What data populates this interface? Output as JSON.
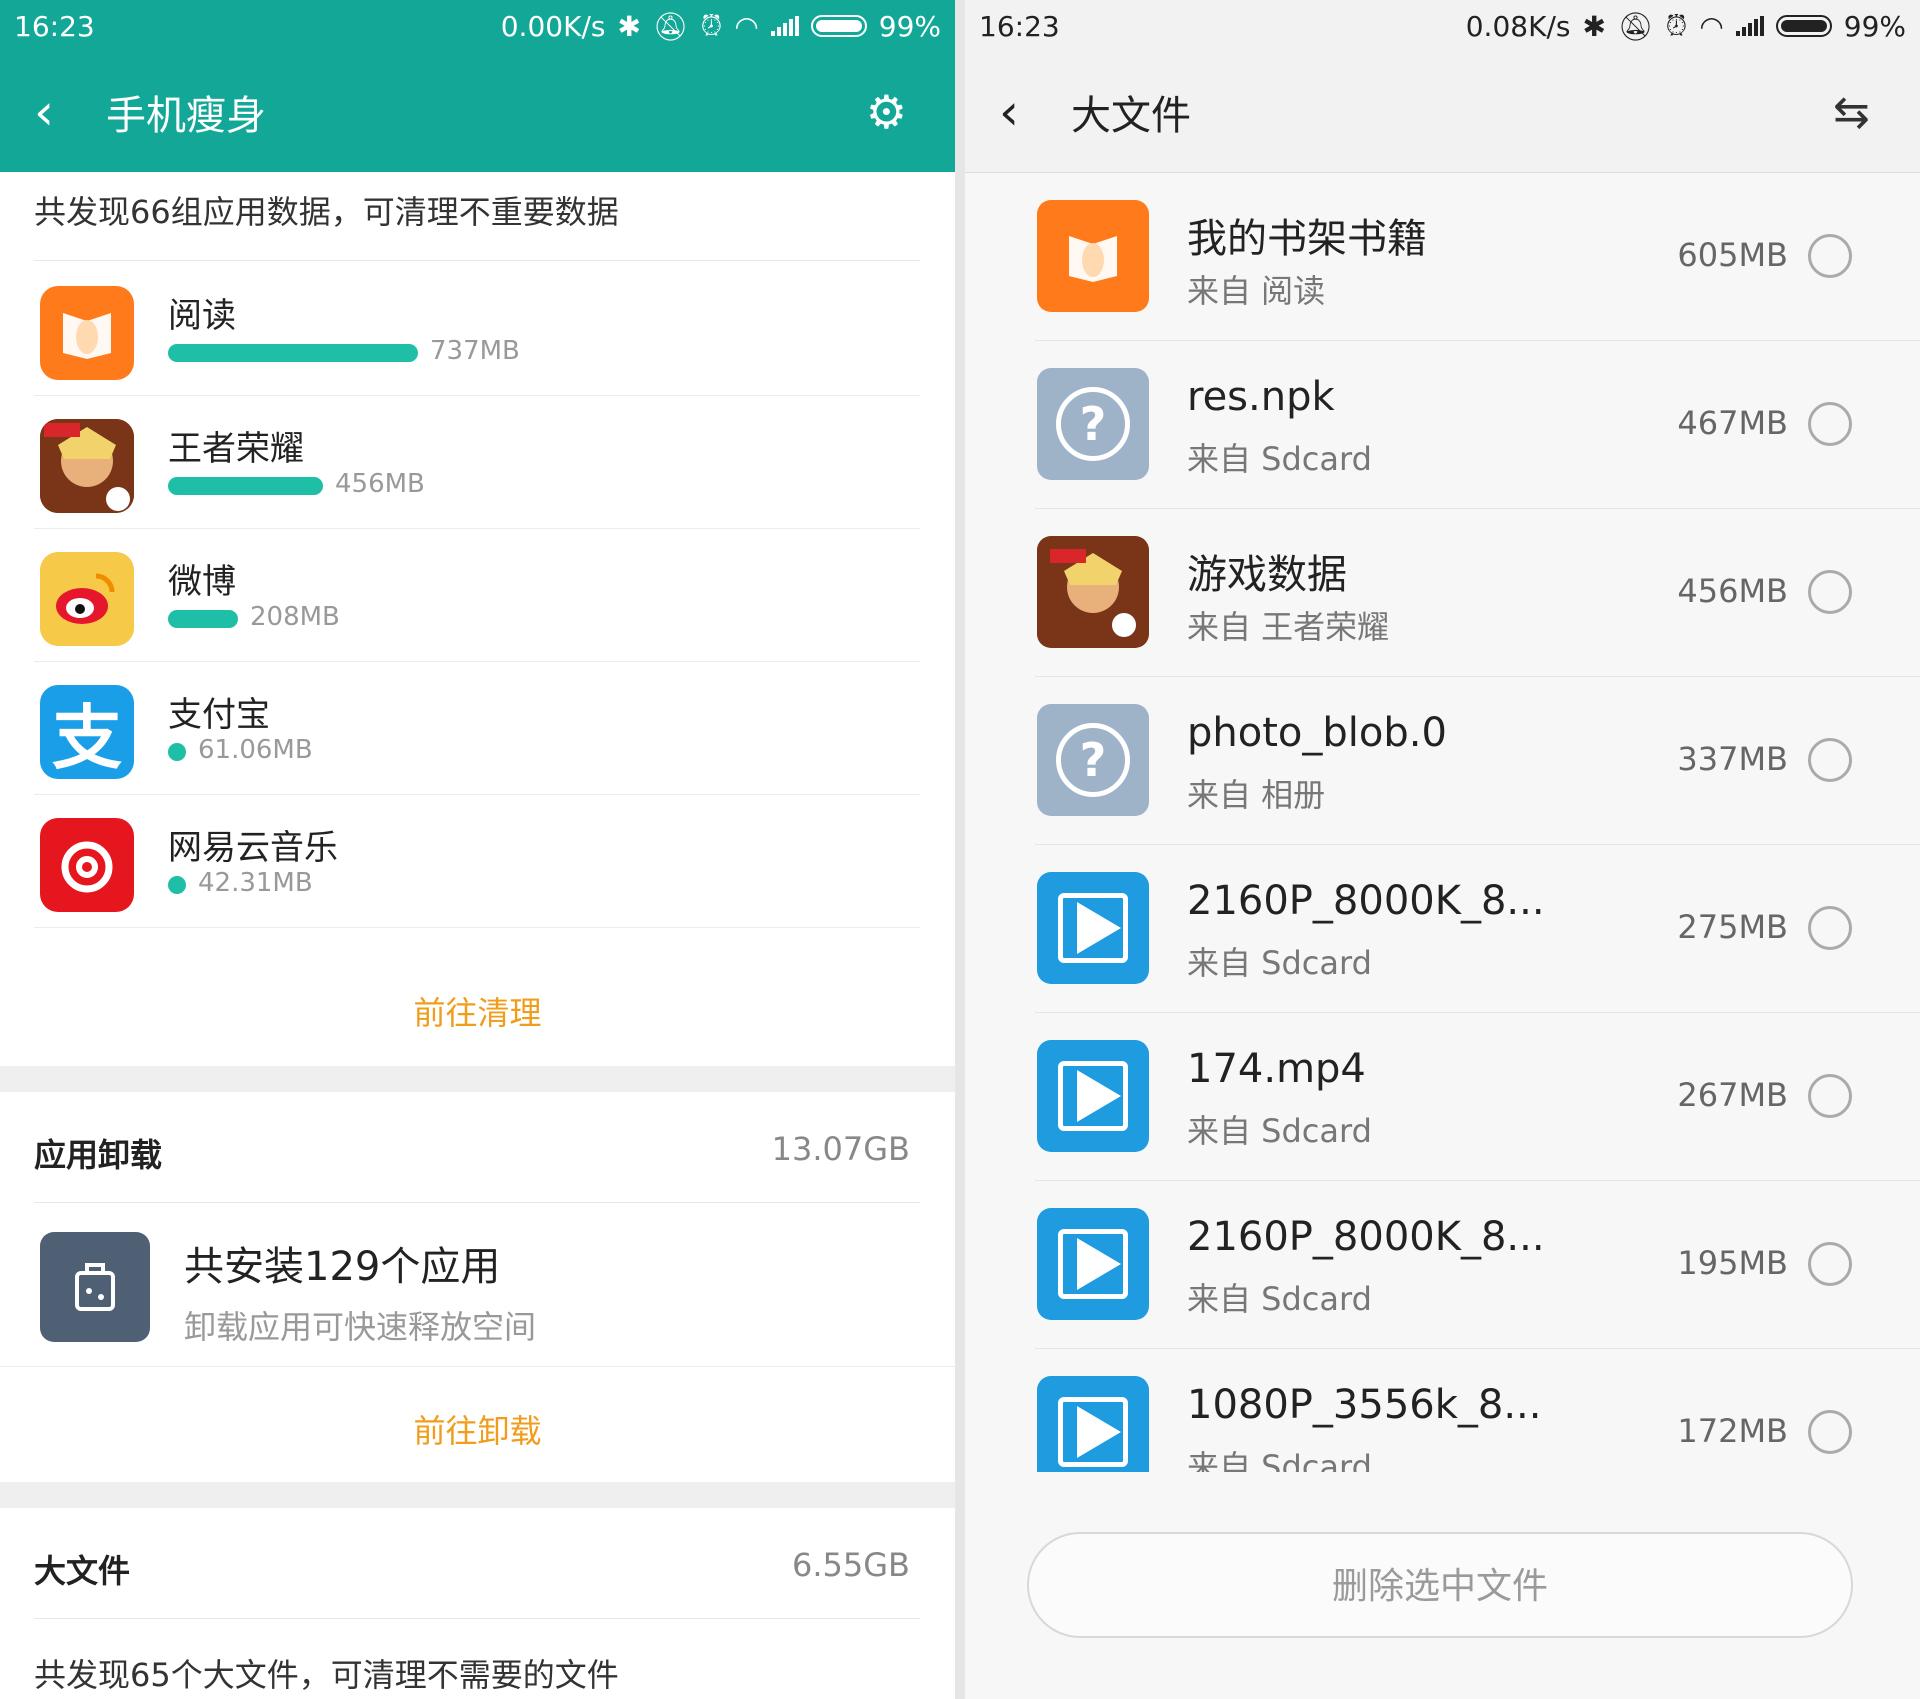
{
  "left": {
    "status": {
      "time": "16:23",
      "speed": "0.00K/s",
      "battery": "99%"
    },
    "title": "手机瘦身",
    "summary": "共发现66组应用数据，可清理不重要数据",
    "apps": [
      {
        "name": "阅读",
        "size": "737MB",
        "fraction": 1.0,
        "icon": "book-icon",
        "color": "#ff7a1a"
      },
      {
        "name": "王者荣耀",
        "size": "456MB",
        "fraction": 0.62,
        "icon": "game-hero-icon",
        "color": "#8a3a1e"
      },
      {
        "name": "微博",
        "size": "208MB",
        "fraction": 0.28,
        "icon": "weibo-icon",
        "color": "#f7c948"
      },
      {
        "name": "支付宝",
        "size": "61.06MB",
        "fraction": 0.0,
        "icon": "alipay-icon",
        "color": "#1a9ee8"
      },
      {
        "name": "网易云音乐",
        "size": "42.31MB",
        "fraction": 0.0,
        "icon": "netease-music-icon",
        "color": "#e5161e"
      }
    ],
    "clean_link": "前往清理",
    "uninstall": {
      "label": "应用卸载",
      "value": "13.07GB",
      "title": "共安装129个应用",
      "subtitle": "卸载应用可快速释放空间",
      "link": "前往卸载"
    },
    "bigfiles": {
      "label": "大文件",
      "value": "6.55GB",
      "note": "共发现65个大文件，可清理不需要的文件"
    }
  },
  "right": {
    "status": {
      "time": "16:23",
      "speed": "0.08K/s",
      "battery": "99%"
    },
    "title": "大文件",
    "files": [
      {
        "name": "我的书架书籍",
        "source": "来自 阅读",
        "size": "605MB",
        "icon": "book-icon"
      },
      {
        "name": "res.npk",
        "source": "来自 Sdcard",
        "size": "467MB",
        "icon": "unknown-file-icon"
      },
      {
        "name": "游戏数据",
        "source": "来自 王者荣耀",
        "size": "456MB",
        "icon": "game-hero-icon"
      },
      {
        "name": "photo_blob.0",
        "source": "来自 相册",
        "size": "337MB",
        "icon": "unknown-file-icon"
      },
      {
        "name": "2160P_8000K_8...",
        "source": "来自 Sdcard",
        "size": "275MB",
        "icon": "video-play-icon"
      },
      {
        "name": "174.mp4",
        "source": "来自 Sdcard",
        "size": "267MB",
        "icon": "video-play-icon"
      },
      {
        "name": "2160P_8000K_8...",
        "source": "来自 Sdcard",
        "size": "195MB",
        "icon": "video-play-icon"
      },
      {
        "name": "1080P_3556k_8...",
        "source": "来自 Sdcard",
        "size": "172MB",
        "icon": "video-play-icon"
      }
    ],
    "delete_button": "删除选中文件"
  },
  "colors": {
    "accent": "#13a797",
    "bar": "#1fbea6",
    "link": "#f09d1b",
    "video": "#1f9be0",
    "unknown": "#9fb3c8"
  }
}
